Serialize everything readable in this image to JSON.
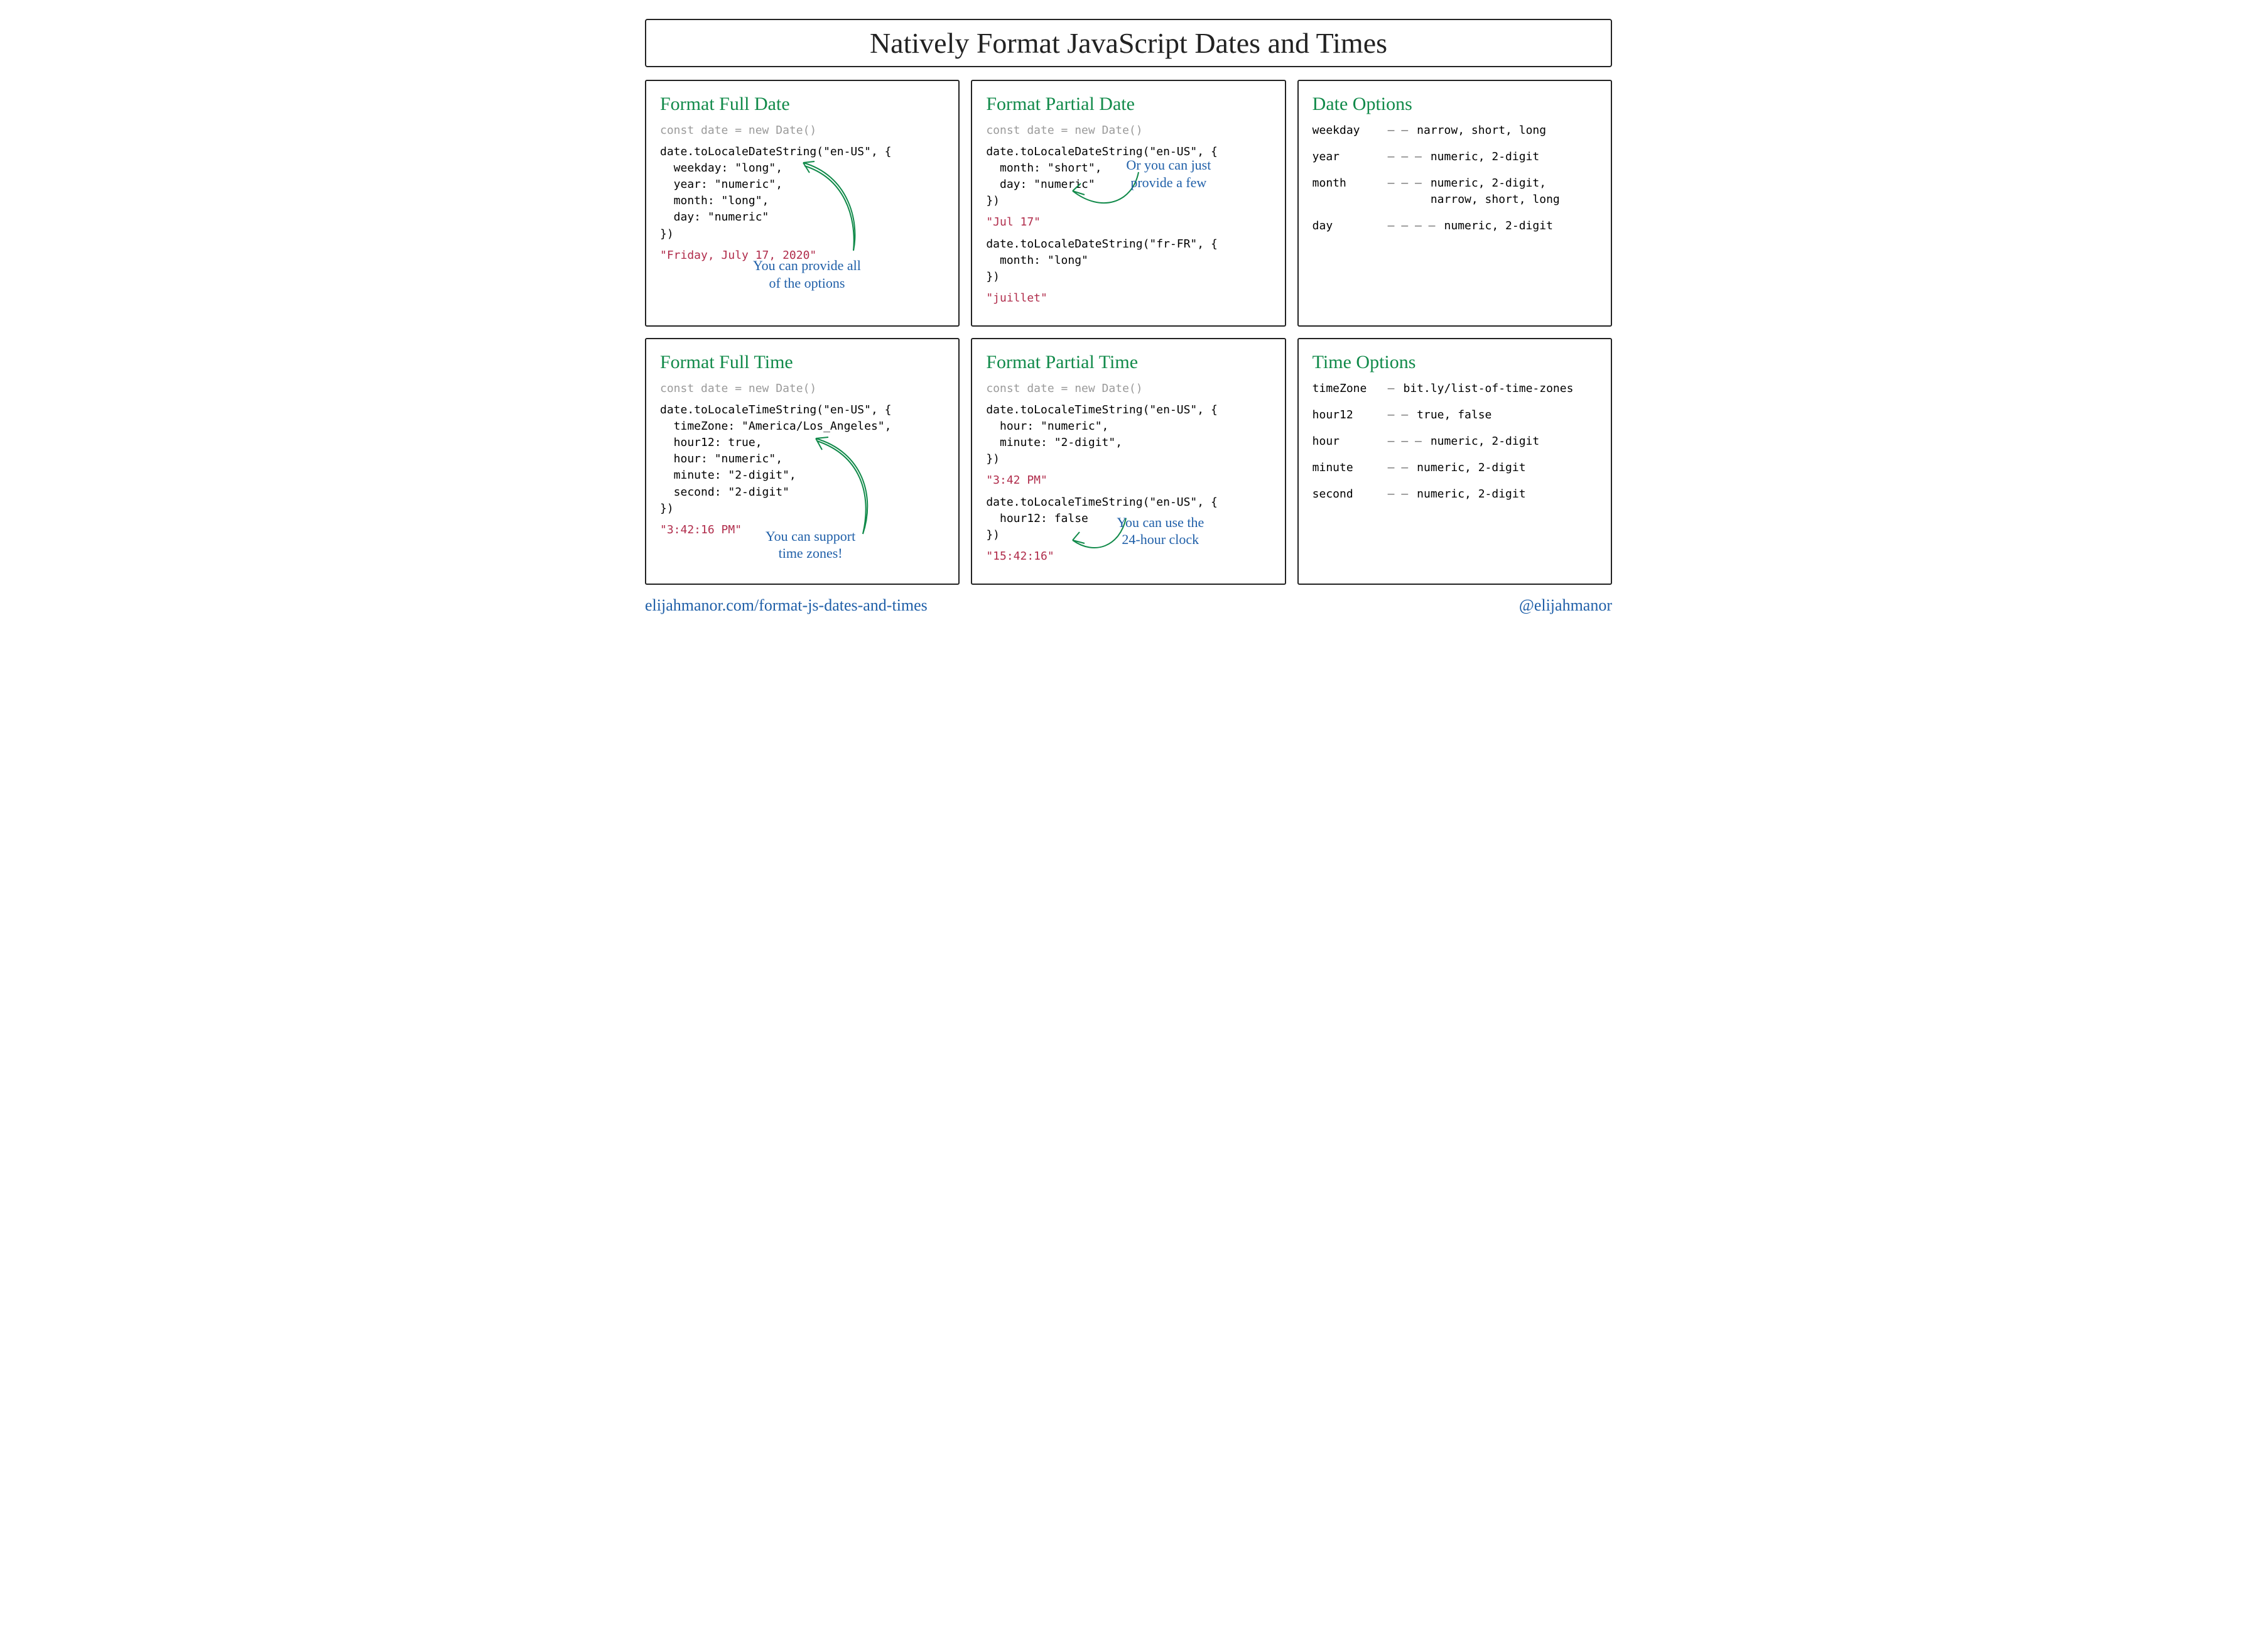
{
  "title": "Natively Format JavaScript Dates and Times",
  "panels": {
    "fullDate": {
      "heading": "Format Full Date",
      "decl": "const date = new Date()",
      "code": "date.toLocaleDateString(\"en-US\", {\n  weekday: \"long\",\n  year: \"numeric\",\n  month: \"long\",\n  day: \"numeric\"\n})",
      "output": "\"Friday, July 17, 2020\"",
      "annot": "You can provide all\nof the options"
    },
    "partialDate": {
      "heading": "Format Partial Date",
      "decl": "const date = new Date()",
      "code1": "date.toLocaleDateString(\"en-US\", {\n  month: \"short\",\n  day: \"numeric\"\n})",
      "output1": "\"Jul 17\"",
      "code2": "date.toLocaleDateString(\"fr-FR\", {\n  month: \"long\"\n})",
      "output2": "\"juillet\"",
      "annot": "Or you can just\nprovide a few"
    },
    "dateOptions": {
      "heading": "Date Options",
      "rows": [
        {
          "key": "weekday",
          "dash": "— —",
          "val": "narrow, short, long"
        },
        {
          "key": "year",
          "dash": "— — —",
          "val": "numeric, 2-digit"
        },
        {
          "key": "month",
          "dash": "— — —",
          "val": "numeric, 2-digit,\nnarrow, short, long"
        },
        {
          "key": "day",
          "dash": "— — — —",
          "val": "numeric, 2-digit"
        }
      ]
    },
    "fullTime": {
      "heading": "Format Full Time",
      "decl": "const date = new Date()",
      "code": "date.toLocaleTimeString(\"en-US\", {\n  timeZone: \"America/Los_Angeles\",\n  hour12: true,\n  hour: \"numeric\",\n  minute: \"2-digit\",\n  second: \"2-digit\"\n})",
      "output": "\"3:42:16 PM\"",
      "annot": "You can support\ntime zones!"
    },
    "partialTime": {
      "heading": "Format Partial Time",
      "decl": "const date = new Date()",
      "code1": "date.toLocaleTimeString(\"en-US\", {\n  hour: \"numeric\",\n  minute: \"2-digit\",\n})",
      "output1": "\"3:42 PM\"",
      "code2": "date.toLocaleTimeString(\"en-US\", {\n  hour12: false\n})",
      "output2": "\"15:42:16\"",
      "annot": "You can use the\n24-hour clock"
    },
    "timeOptions": {
      "heading": "Time Options",
      "rows": [
        {
          "key": "timeZone",
          "dash": "—",
          "val": "bit.ly/list-of-time-zones"
        },
        {
          "key": "hour12",
          "dash": "— —",
          "val": "true, false"
        },
        {
          "key": "hour",
          "dash": "— — —",
          "val": "numeric, 2-digit"
        },
        {
          "key": "minute",
          "dash": "— —",
          "val": "numeric, 2-digit"
        },
        {
          "key": "second",
          "dash": "— —",
          "val": "numeric, 2-digit"
        }
      ]
    }
  },
  "footer": {
    "left": "elijahmanor.com/format-js-dates-and-times",
    "right": "@elijahmanor"
  }
}
